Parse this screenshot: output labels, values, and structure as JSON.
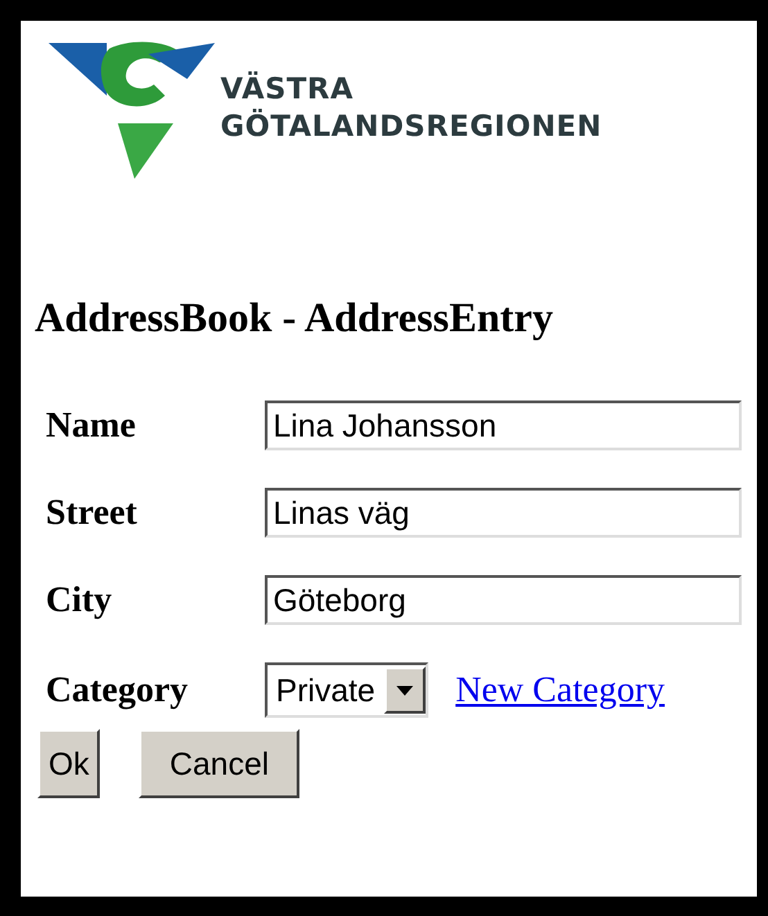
{
  "logo": {
    "lines": [
      "VÄSTRA",
      "GÖTALANDSREGIONEN"
    ]
  },
  "heading": "AddressBook - AddressEntry",
  "fields": [
    {
      "label": "Name",
      "value": "Lina Johansson"
    },
    {
      "label": "Street",
      "value": "Linas väg"
    },
    {
      "label": "City",
      "value": "Göteborg"
    }
  ],
  "category": {
    "label": "Category",
    "value": "Private",
    "link": "New Category"
  },
  "buttons": [
    "Ok",
    "Cancel"
  ]
}
